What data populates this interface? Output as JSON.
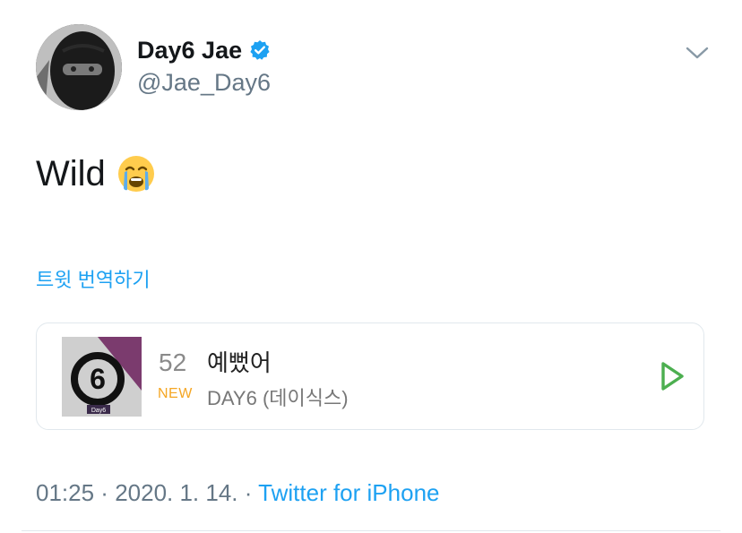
{
  "user": {
    "display_name": "Day6 Jae",
    "handle": "@Jae_Day6",
    "avatar_icon": "avatar-icon",
    "verified_icon": "verified-badge-icon",
    "verified_color": "#1da1f2"
  },
  "tweet": {
    "text": "Wild",
    "emoji": "loudly-crying-face"
  },
  "translate_label": "트윗 번역하기",
  "music_card": {
    "rank": "52",
    "badge": "NEW",
    "title": "예뻤어",
    "artist": "DAY6 (데이식스)",
    "album_label": "Day6",
    "play_icon": "play-icon",
    "play_color": "#4caf50",
    "badge_color": "#f5a623"
  },
  "meta": {
    "time": "01:25",
    "separator1": " · ",
    "date": "2020. 1. 14.",
    "separator2": " · ",
    "source": "Twitter for iPhone"
  },
  "menu_icon": "chevron-down-icon",
  "accent_color": "#1da1f2"
}
